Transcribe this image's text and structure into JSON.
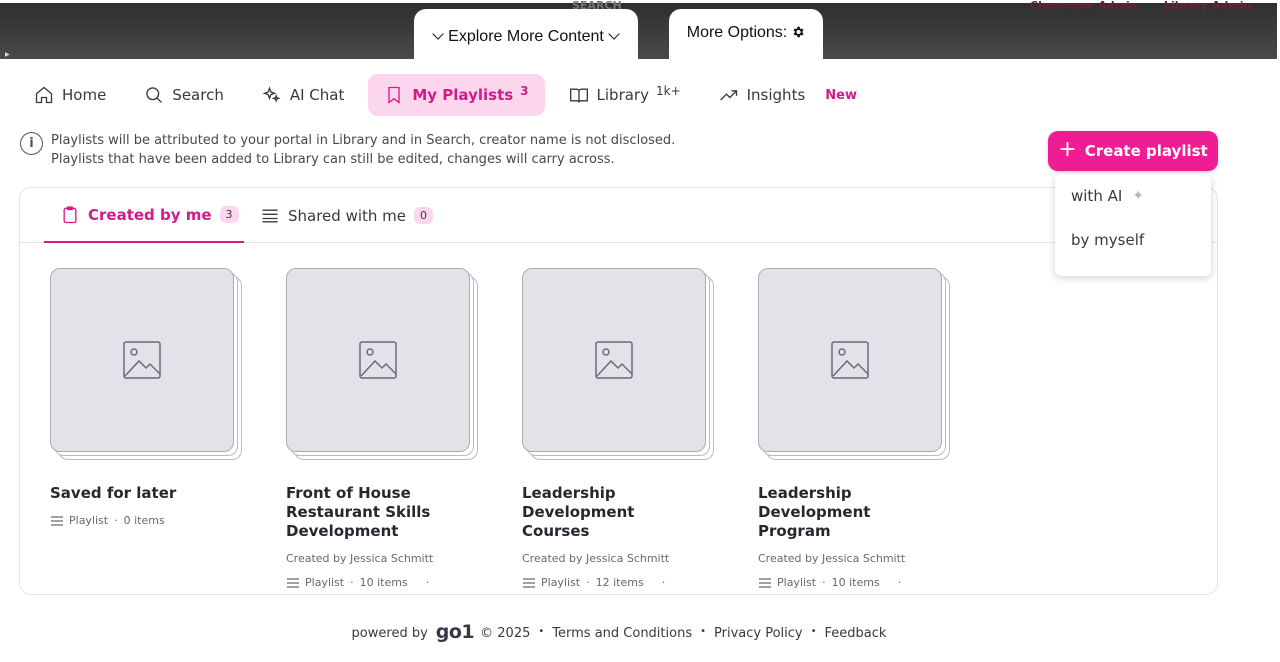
{
  "topbar": {
    "faded_left": "SEARCH",
    "faded_right_1": "Classroom Admin",
    "faded_right_2": "Library Admin",
    "explore_label": "Explore More Content",
    "more_options_label": "More Options:",
    "more_options_icon": "gear-icon"
  },
  "nav": {
    "home": "Home",
    "search": "Search",
    "ai_chat": "AI Chat",
    "my_playlists": "My Playlists",
    "my_playlists_count": "3",
    "library": "Library",
    "library_count": "1k+",
    "insights": "Insights",
    "insights_badge": "New"
  },
  "info": {
    "line1": "Playlists will be attributed to your portal in Library and in Search, creator name is not disclosed.",
    "line2": "Playlists that have been added to Library can still be edited, changes will carry across."
  },
  "create": {
    "label": "Create playlist",
    "options": [
      "with AI",
      "by myself"
    ]
  },
  "tabs": {
    "created": "Created by me",
    "created_count": "3",
    "shared": "Shared with me",
    "shared_count": "0"
  },
  "cards": [
    {
      "title": "Saved for later",
      "creator": "",
      "type": "Playlist",
      "items": "0 items"
    },
    {
      "title": "Front of House Restaurant Skills Development",
      "creator": "Created by Jessica Schmitt",
      "type": "Playlist",
      "items": "10 items"
    },
    {
      "title": "Leadership Development Courses",
      "creator": "Created by Jessica Schmitt",
      "type": "Playlist",
      "items": "12 items"
    },
    {
      "title": "Leadership Development Program",
      "creator": "Created by Jessica Schmitt",
      "type": "Playlist",
      "items": "10 items"
    }
  ],
  "footer": {
    "powered_by": "powered by",
    "logo": "go1",
    "copyright": "© 2025",
    "terms": "Terms and Conditions",
    "privacy": "Privacy Policy",
    "feedback": "Feedback"
  },
  "colors": {
    "accent": "#ee1d93",
    "accent_text": "#d6198a",
    "accent_light": "#fbd6ec"
  }
}
